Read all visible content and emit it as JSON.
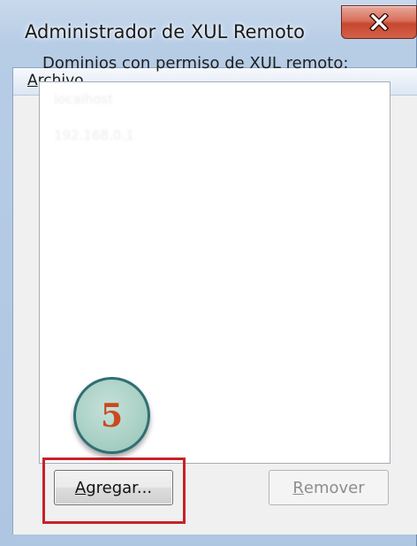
{
  "window": {
    "title": "Administrador de XUL Remoto",
    "close_label": "X"
  },
  "menu": {
    "archivo_prefix": "A",
    "archivo_rest": "rchivo"
  },
  "content": {
    "domains_label": "Dominios con permiso de XUL remoto:",
    "domains": [
      "localhost",
      "192.168.0.1"
    ]
  },
  "buttons": {
    "agregar_prefix": "A",
    "agregar_rest": "gregar...",
    "remover_prefix": "R",
    "remover_rest": "emover"
  },
  "annotation": {
    "step_number": "5",
    "badge_color": "#a9d0c4",
    "number_color": "#c84a1f",
    "highlight_color": "#c6222a"
  }
}
